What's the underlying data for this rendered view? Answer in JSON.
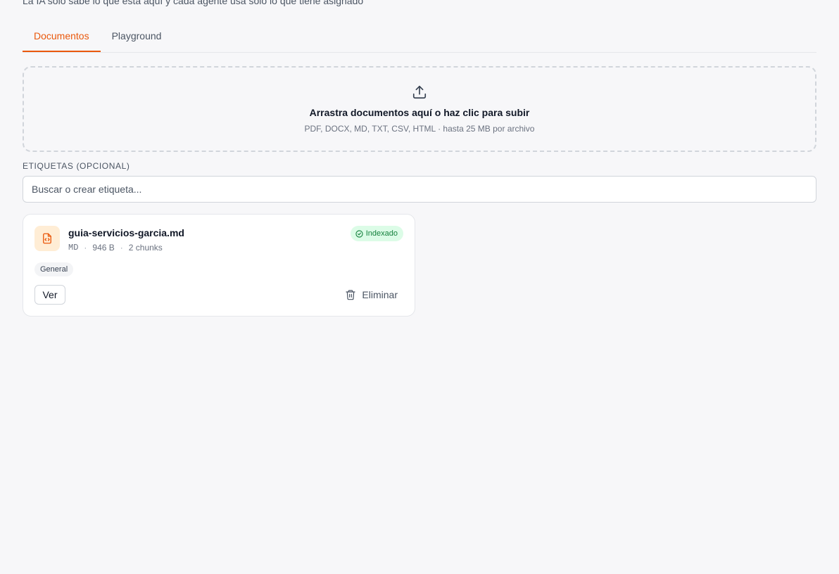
{
  "header": {
    "subtitle": "La IA solo sabe lo que está aquí y cada agente usa solo lo que tiene asignado"
  },
  "tabs": [
    {
      "label": "Documentos",
      "active": true
    },
    {
      "label": "Playground",
      "active": false
    }
  ],
  "dropzone": {
    "icon": "upload-icon",
    "title": "Arrastra documentos aquí o haz clic para subir",
    "hint": "PDF, DOCX, MD, TXT, CSV, HTML · hasta 25 MB por archivo"
  },
  "tags_field": {
    "label": "Etiquetas (opcional)",
    "placeholder": "Buscar o crear etiqueta..."
  },
  "documents": [
    {
      "name": "guia-servicios-garcia.md",
      "type": "MD",
      "size": "946 B",
      "chunks": "2 chunks",
      "status": "Indexado",
      "tags": [
        "General"
      ],
      "view_label": "Ver",
      "delete_label": "Eliminar"
    }
  ],
  "colors": {
    "accent": "#ea580c",
    "status_ok_bg": "#dcfce7",
    "status_ok_text": "#15803d"
  }
}
